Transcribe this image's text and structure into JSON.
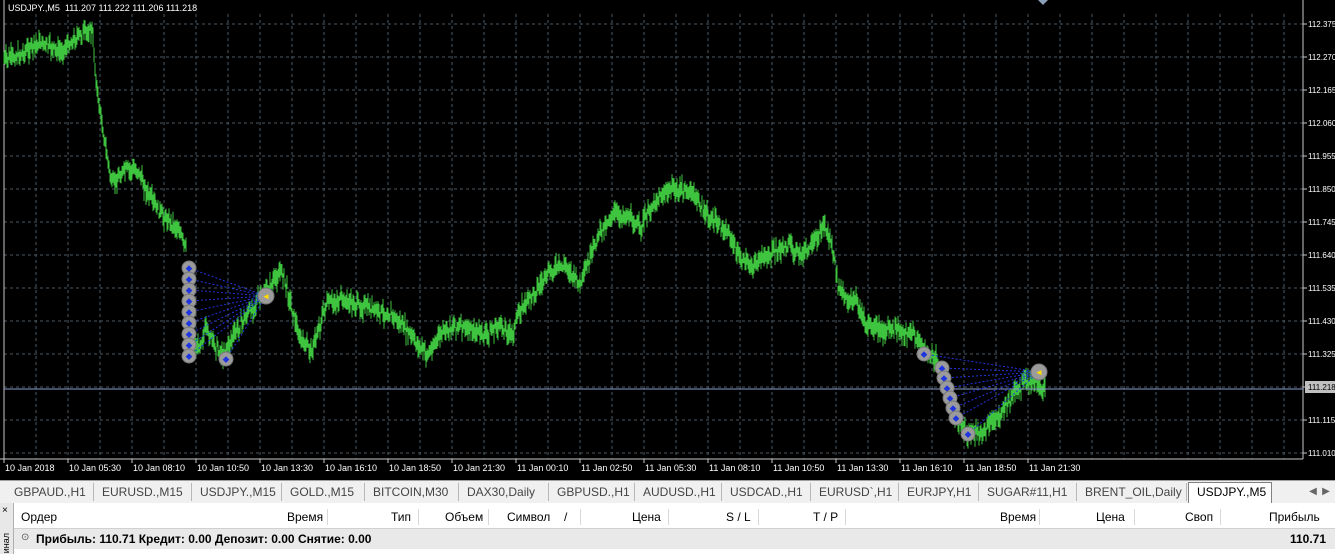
{
  "chart": {
    "header": "USDJPY.,M5  111.207 111.222 111.206 111.218",
    "current_price": "111.218",
    "price_labels": [
      "112.375",
      "112.270",
      "112.165",
      "112.060",
      "111.955",
      "111.850",
      "111.745",
      "111.640",
      "111.535",
      "111.430",
      "111.325",
      "111.218",
      "111.115",
      "111.010"
    ],
    "time_labels": [
      "10 Jan 2018",
      "10 Jan 05:30",
      "10 Jan 08:10",
      "10 Jan 10:50",
      "10 Jan 13:30",
      "10 Jan 16:10",
      "10 Jan 18:50",
      "10 Jan 21:30",
      "11 Jan 00:10",
      "11 Jan 02:50",
      "11 Jan 05:30",
      "11 Jan 08:10",
      "11 Jan 10:50",
      "11 Jan 13:30",
      "11 Jan 16:10",
      "11 Jan 18:50",
      "11 Jan 21:30"
    ],
    "colors": {
      "background": "#000000",
      "grid": "#4a5a66",
      "bars": "#3ec43e",
      "current_line": "#8a9fcf",
      "trade_marker": "#9b9b9b",
      "trade_line": "#2233dd"
    }
  },
  "tabs": [
    {
      "label": "GBPAUD.,H1"
    },
    {
      "label": "EURUSD.,M15"
    },
    {
      "label": "USDJPY.,M15"
    },
    {
      "label": "GOLD.,M15"
    },
    {
      "label": "BITCOIN,M30"
    },
    {
      "label": "DAX30,Daily"
    },
    {
      "label": "GBPUSD.,H1"
    },
    {
      "label": "AUDUSD.,H1"
    },
    {
      "label": "USDCAD.,H1"
    },
    {
      "label": "EURUSD`,H1"
    },
    {
      "label": "EURJPY,H1"
    },
    {
      "label": "SUGAR#11,H1"
    },
    {
      "label": "BRENT_OIL,Daily"
    },
    {
      "label": "USDJPY.,M5"
    }
  ],
  "active_tab": "USDJPY.,M5",
  "terminal": {
    "close_icon": "×",
    "side_label": "инал",
    "columns": [
      "Ордер",
      "Время",
      "Тип",
      "Объем",
      "Символ",
      "/",
      "Цена",
      "S / L",
      "T / P",
      "Время",
      "Цена",
      "Своп",
      "Прибыль"
    ],
    "summary": "Прибыль: 110.71  Кредит: 0.00  Депозит: 0.00  Снятие: 0.00",
    "total_profit": "110.71"
  }
}
